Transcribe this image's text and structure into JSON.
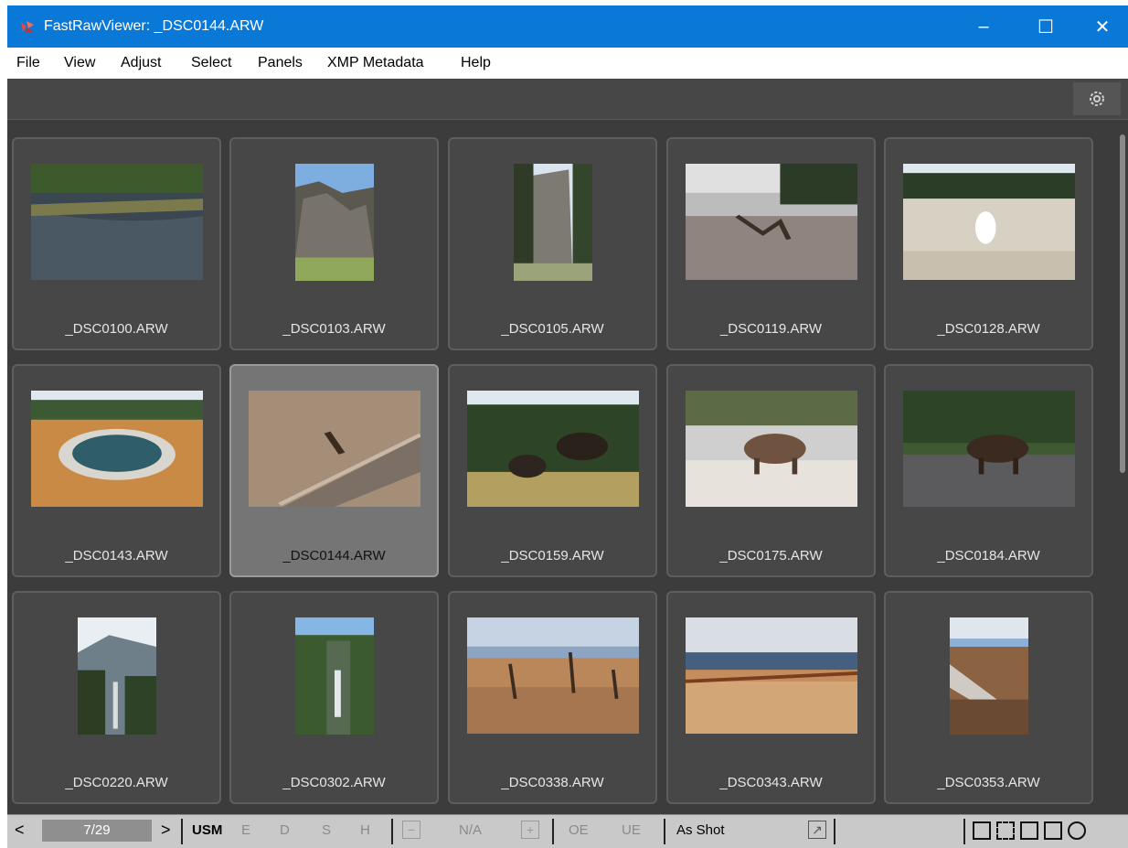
{
  "window": {
    "title": "FastRawViewer: _DSC0144.ARW",
    "minimize": "–",
    "maximize": "☐",
    "close": "✕",
    "accent": "#0a78d7"
  },
  "menu": [
    "File",
    "View",
    "Adjust",
    "Select",
    "Panels",
    "XMP Metadata",
    "Help"
  ],
  "toolbar": {
    "settings_icon": "gear-icon"
  },
  "thumbnails": [
    {
      "label": "_DSC0100.ARW",
      "scene": "river"
    },
    {
      "label": "_DSC0103.ARW",
      "scene": "cliff"
    },
    {
      "label": "_DSC0105.ARW",
      "scene": "rockpillar"
    },
    {
      "label": "_DSC0119.ARW",
      "scene": "steam"
    },
    {
      "label": "_DSC0128.ARW",
      "scene": "geyser"
    },
    {
      "label": "_DSC0143.ARW",
      "scene": "hotspring"
    },
    {
      "label": "_DSC0144.ARW",
      "scene": "boardwalk",
      "selected": true
    },
    {
      "label": "_DSC0159.ARW",
      "scene": "bison2"
    },
    {
      "label": "_DSC0175.ARW",
      "scene": "bison"
    },
    {
      "label": "_DSC0184.ARW",
      "scene": "bisonroad"
    },
    {
      "label": "_DSC0220.ARW",
      "scene": "falls"
    },
    {
      "label": "_DSC0302.ARW",
      "scene": "falls2"
    },
    {
      "label": "_DSC0338.ARW",
      "scene": "terrace"
    },
    {
      "label": "_DSC0343.ARW",
      "scene": "terrace2"
    },
    {
      "label": "_DSC0353.ARW",
      "scene": "terrace3"
    }
  ],
  "status": {
    "prev": "<",
    "counter": "7/29",
    "next": ">",
    "usm": "USM",
    "e": "E",
    "d": "D",
    "s": "S",
    "h": "H",
    "minus": "−",
    "na": "N/A",
    "plus": "+",
    "oe": "OE",
    "ue": "UE",
    "wb": "As Shot"
  }
}
